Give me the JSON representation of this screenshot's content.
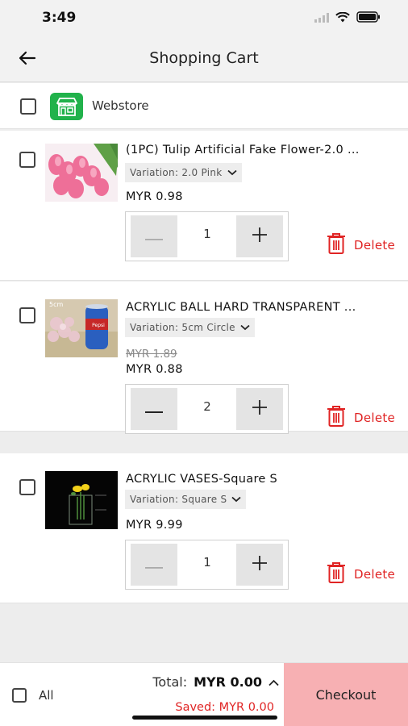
{
  "status_bar": {
    "time": "3:49"
  },
  "header": {
    "title": "Shopping Cart"
  },
  "store": {
    "name": "Webstore"
  },
  "items": [
    {
      "name": "(1PC) Tulip Artificial Fake Flower-2.0 ...",
      "variation": "Variation: 2.0 Pink",
      "original_price": "",
      "price": "MYR 0.98",
      "quantity": "1",
      "delete_label": "Delete"
    },
    {
      "name": "ACRYLIC BALL HARD TRANSPARENT ...",
      "variation": "Variation: 5cm Circle",
      "original_price": "MYR 1.89",
      "price": "MYR 0.88",
      "quantity": "2",
      "delete_label": "Delete",
      "thumb_label": "5cm"
    },
    {
      "name": "ACRYLIC VASES-Square S",
      "variation": "Variation: Square S",
      "original_price": "",
      "price": "MYR 9.99",
      "quantity": "1",
      "delete_label": "Delete"
    }
  ],
  "footer": {
    "all_label": "All",
    "total_label": "Total:",
    "total_value": "MYR 0.00",
    "saved_text": "Saved: MYR 0.00",
    "checkout_label": "Checkout"
  },
  "colors": {
    "accent_red": "#e02424",
    "checkout_bg": "#f7b0b3",
    "store_green": "#21b24b"
  },
  "icons": [
    "back-arrow-icon",
    "wifi-icon",
    "battery-icon",
    "signal-icon",
    "store-icon",
    "minus-icon",
    "plus-icon",
    "trash-icon",
    "chevron-down-icon",
    "chevron-up-icon"
  ]
}
